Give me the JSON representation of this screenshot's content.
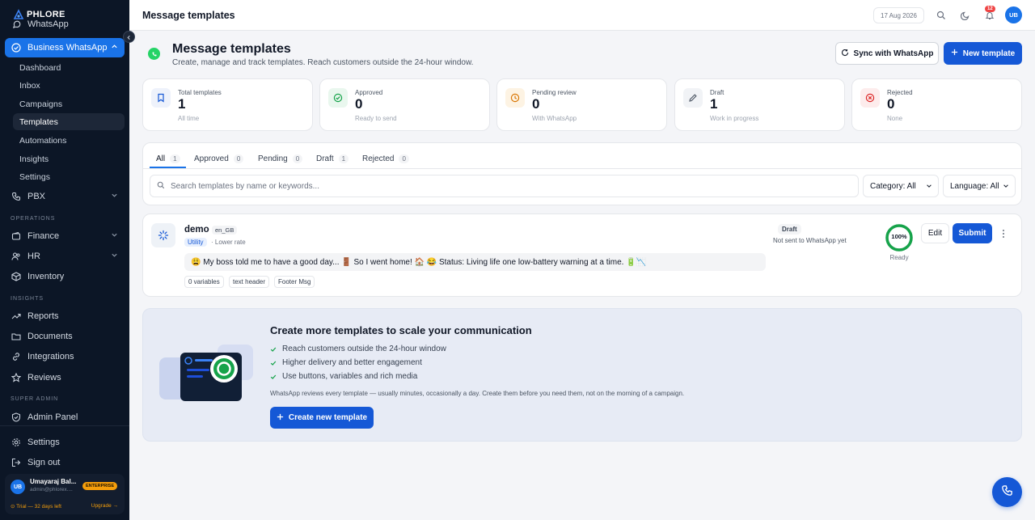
{
  "brand": {
    "name": "PHLORE"
  },
  "sidebar": {
    "top_partial_item": "WhatsApp",
    "business_whatsapp": "Business WhatsApp",
    "sub_items": [
      {
        "label": "Dashboard"
      },
      {
        "label": "Inbox"
      },
      {
        "label": "Campaigns"
      },
      {
        "label": "Templates"
      },
      {
        "label": "Automations"
      },
      {
        "label": "Insights"
      },
      {
        "label": "Settings"
      }
    ],
    "pbx": "PBX",
    "section_operations": "OPERATIONS",
    "finance": "Finance",
    "hr": "HR",
    "inventory": "Inventory",
    "section_insights": "INSIGHTS",
    "reports": "Reports",
    "documents": "Documents",
    "integrations": "Integrations",
    "reviews": "Reviews",
    "section_super_admin": "SUPER ADMIN",
    "admin_panel": "Admin Panel",
    "settings": "Settings",
    "sign_out": "Sign out",
    "user": {
      "initials": "UB",
      "name": "Umayaraj Bal...",
      "email": "admin@phlorex....",
      "plan_badge": "ENTERPRISE",
      "trial_text": "⊙ Trial — 32 days left",
      "upgrade_text": "Upgrade →"
    }
  },
  "topbar": {
    "title": "Message templates",
    "date": "17 Aug 2026",
    "notification_count": "12",
    "avatar_initials": "UB"
  },
  "page_header": {
    "title": "Message templates",
    "subtitle": "Create, manage and track templates. Reach customers outside the 24-hour window.",
    "sync_button": "Sync with WhatsApp",
    "new_button": "New template"
  },
  "stats": [
    {
      "label": "Total templates",
      "value": "1",
      "sub": "All time",
      "icon": "bookmark-icon",
      "color": "#1558d6",
      "bg": "#eef2fb"
    },
    {
      "label": "Approved",
      "value": "0",
      "sub": "Ready to send",
      "icon": "check-circle-icon",
      "color": "#16a34a",
      "bg": "#e9f7ee"
    },
    {
      "label": "Pending review",
      "value": "0",
      "sub": "With WhatsApp",
      "icon": "clock-icon",
      "color": "#d97706",
      "bg": "#fdf3e3"
    },
    {
      "label": "Draft",
      "value": "1",
      "sub": "Work in progress",
      "icon": "pencil-icon",
      "color": "#4b5563",
      "bg": "#f1f3f6"
    },
    {
      "label": "Rejected",
      "value": "0",
      "sub": "None",
      "icon": "x-circle-icon",
      "color": "#dc2626",
      "bg": "#fdecec"
    }
  ],
  "tabs": [
    {
      "label": "All",
      "count": "1"
    },
    {
      "label": "Approved",
      "count": "0"
    },
    {
      "label": "Pending",
      "count": "0"
    },
    {
      "label": "Draft",
      "count": "1"
    },
    {
      "label": "Rejected",
      "count": "0"
    }
  ],
  "filters": {
    "search_placeholder": "Search templates by name or keywords...",
    "category": "Category: All",
    "language": "Language: All"
  },
  "template": {
    "name": "demo",
    "language": "en_GB",
    "category": "Utility",
    "rate_note": "· Lower rate",
    "preview": "😩 My boss told me to have a good day... 🚪 So I went home! 🏠 😂 Status: Living life one low-battery warning at a time. 🔋📉",
    "chips": [
      "0 variables",
      "text header",
      "Footer Msg"
    ],
    "status": "Draft",
    "status_sub": "Not sent to WhatsApp yet",
    "readiness": "100%",
    "readiness_fraction": 1.0,
    "readiness_label": "Ready",
    "edit_button": "Edit",
    "submit_button": "Submit"
  },
  "promo": {
    "title": "Create more templates to scale your communication",
    "bullets": [
      "Reach customers outside the 24-hour window",
      "Higher delivery and better engagement",
      "Use buttons, variables and rich media"
    ],
    "note": "WhatsApp reviews every template — usually minutes, occasionally a day. Create them before you need them, not on the morning of a campaign.",
    "button": "Create new template"
  },
  "colors": {
    "accent": "#1558d6",
    "sidebar_bg": "#0c1626",
    "whatsapp_green": "#25d366",
    "success": "#16a34a"
  }
}
